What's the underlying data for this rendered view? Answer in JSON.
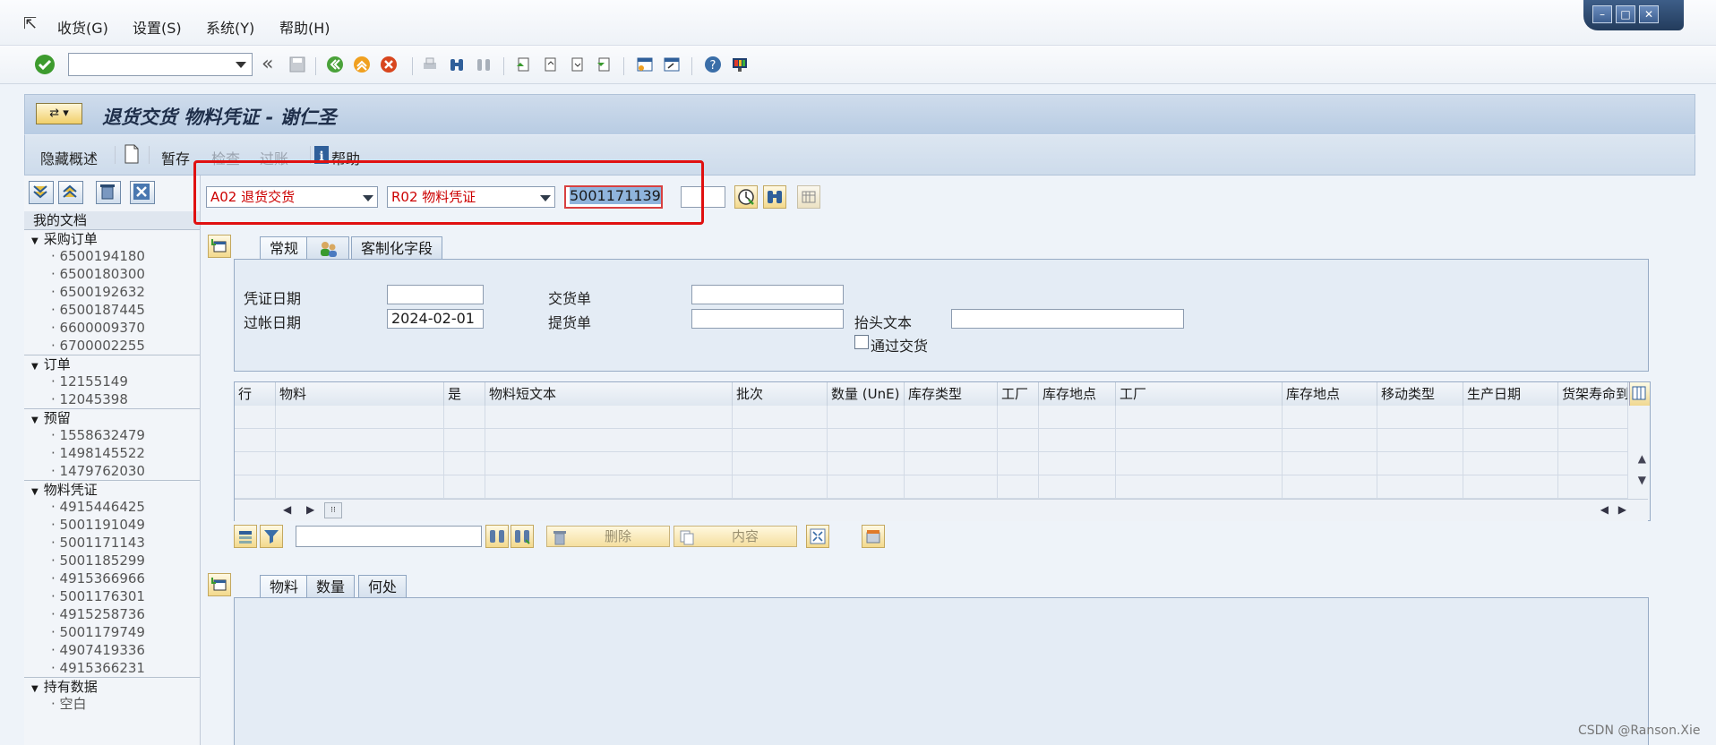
{
  "menu": {
    "items": [
      "收货(G)",
      "设置(S)",
      "系统(Y)",
      "帮助(H)"
    ]
  },
  "toolbar": {
    "command_field": ""
  },
  "title": "退货交货 物料凭证 - 谢仁圣",
  "app_toolbar": {
    "hide_overview": "隐藏概述",
    "hold": "暂存",
    "check": "检查",
    "post": "过账",
    "help": "帮助"
  },
  "left_panel": {
    "root": "我的文档",
    "groups": [
      {
        "label": "采购订单",
        "items": [
          "6500194180",
          "6500180300",
          "6500192632",
          "6500187445",
          "6600009370",
          "6700002255"
        ]
      },
      {
        "label": "订单",
        "items": [
          "12155149",
          "12045398"
        ]
      },
      {
        "label": "预留",
        "items": [
          "1558632479",
          "1498145522",
          "1479762030"
        ]
      },
      {
        "label": "物料凭证",
        "items": [
          "4915446425",
          "5001191049",
          "5001171143",
          "5001185299",
          "4915366966",
          "5001176301",
          "4915258736",
          "5001179749",
          "4907419336",
          "4915366231"
        ]
      },
      {
        "label": "持有数据",
        "items": [
          "空白"
        ]
      }
    ]
  },
  "selection": {
    "action": "A02 退货交货",
    "reference": "R02 物料凭证",
    "doc_number": "5001171139",
    "year": ""
  },
  "header_tabs": [
    "常规",
    "客制化字段"
  ],
  "header": {
    "doc_date_label": "凭证日期",
    "doc_date": "",
    "post_date_label": "过帐日期",
    "post_date": "2024-02-01",
    "delivery_label": "交货单",
    "delivery": "",
    "bill_label": "提货单",
    "bill": "",
    "header_text_label": "抬头文本",
    "header_text": "",
    "via_delivery_label": "通过交货"
  },
  "grid": {
    "columns": [
      "行",
      "物料",
      "是",
      "物料短文本",
      "批次",
      "数量 (UnE)",
      "库存类型",
      "工厂",
      "库存地点",
      "工厂",
      "库存地点",
      "移动类型",
      "生产日期",
      "货架寿命到"
    ]
  },
  "grid_toolbar": {
    "search": "",
    "delete": "删除",
    "content": "内容"
  },
  "detail_tabs": [
    "物料",
    "数量",
    "何处"
  ],
  "watermark": "CSDN @Ranson.Xie",
  "colors": {
    "highlight_box": "#e01010",
    "accent_red": "#cc0000"
  }
}
